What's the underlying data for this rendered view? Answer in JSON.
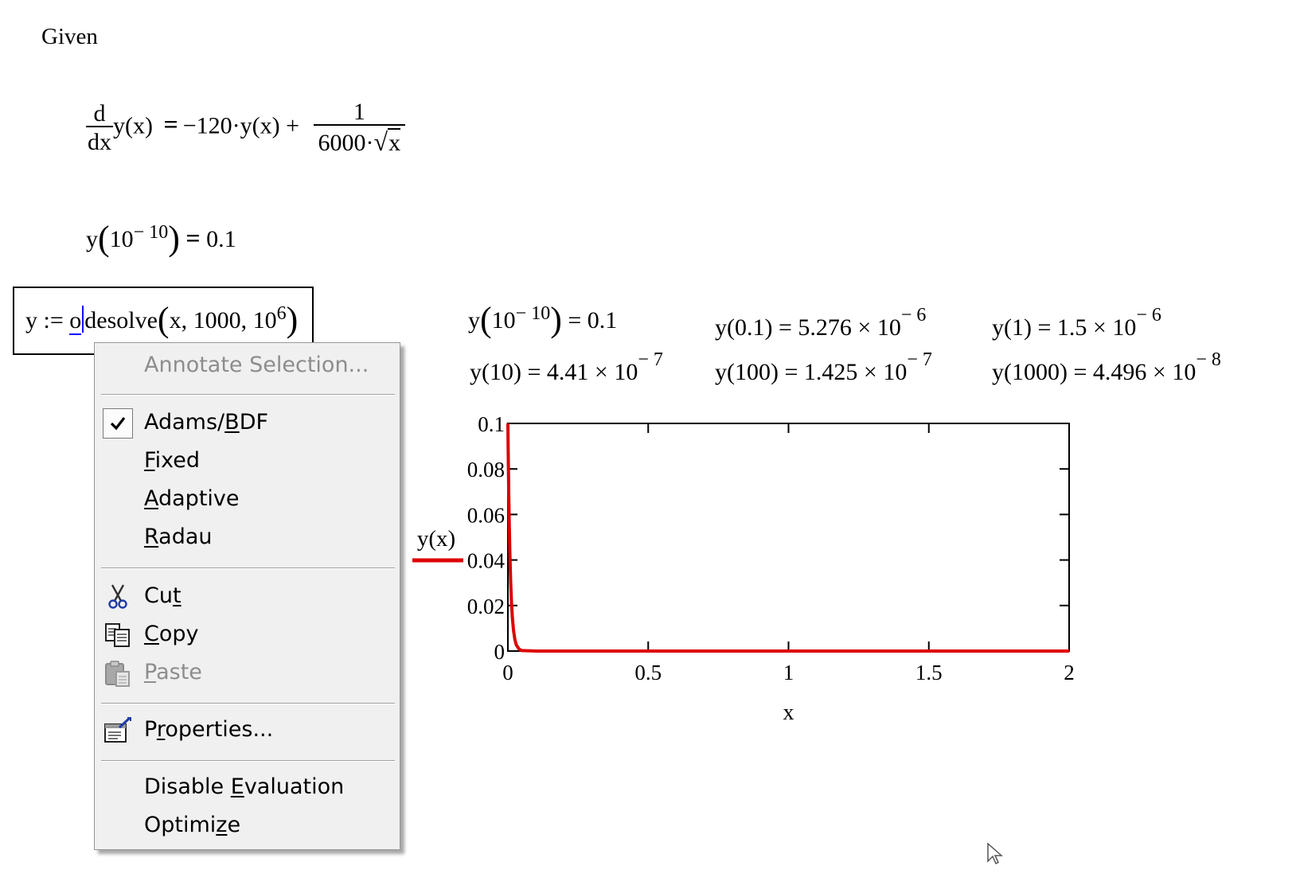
{
  "worksheet": {
    "given_label": "Given",
    "ode": {
      "d_top": "d",
      "d_bottom": "dx",
      "lhs_func": "y(x)",
      "equals": "=",
      "rhs_term": "−120·y(x) +",
      "frac_num": "1",
      "frac_den_prefix": "6000·",
      "frac_den_radicand": "x"
    },
    "initial_condition": {
      "func": "y",
      "arg_base": "10",
      "arg_exp": "− 10",
      "equals": "=",
      "value": "0.1"
    },
    "solve_definition": {
      "lhs": "y :=",
      "func_first_char": "o",
      "func_rest": "desolve",
      "args": "x, 1000, 10",
      "arg_exp": "6"
    }
  },
  "results": {
    "r1": {
      "func": "y",
      "arg_base": "10",
      "arg_exp": "− 10",
      "rhs": "= 0.1"
    },
    "r2": {
      "lhs": "y(0.1)",
      "rhs": "= 5.276 × 10",
      "exp": "− 6"
    },
    "r3": {
      "lhs": "y(1)",
      "rhs": "= 1.5 × 10",
      "exp": "− 6"
    },
    "r4": {
      "lhs": "y(10)",
      "rhs": "= 4.41 × 10",
      "exp": "− 7"
    },
    "r5": {
      "lhs": "y(100)",
      "rhs": "= 1.425 × 10",
      "exp": "− 7"
    },
    "r6": {
      "lhs": "y(1000)",
      "rhs": "= 4.496 × 10",
      "exp": "− 8"
    }
  },
  "context_menu": {
    "annotate": "Annotate Selection...",
    "adams_pre": "Adams/",
    "adams_u": "B",
    "adams_post": "DF",
    "fixed_u": "F",
    "fixed_post": "ixed",
    "adaptive_u": "A",
    "adaptive_post": "daptive",
    "radau_u": "R",
    "radau_post": "adau",
    "cut_pre": "Cu",
    "cut_u": "t",
    "copy_u": "C",
    "copy_post": "opy",
    "paste_u": "P",
    "paste_post": "aste",
    "props_pre": "P",
    "props_u": "r",
    "props_post": "operties...",
    "disable_pre": "Disable ",
    "disable_u": "E",
    "disable_post": "valuation",
    "optimize_pre": "Optimi",
    "optimize_u": "z",
    "optimize_post": "e",
    "icons": {
      "check": "checkmark-icon",
      "cut": "scissors-icon",
      "copy": "copy-icon",
      "paste": "paste-icon",
      "properties": "properties-icon"
    }
  },
  "chart_data": {
    "type": "line",
    "xlabel": "x",
    "ylabel": "y(x)",
    "xlim": [
      0,
      2
    ],
    "ylim": [
      0,
      0.1
    ],
    "x_ticks": [
      "0",
      "0.5",
      "1",
      "1.5",
      "2"
    ],
    "y_ticks": [
      "0",
      "0.02",
      "0.04",
      "0.06",
      "0.08",
      "0.1"
    ],
    "grid": false,
    "series": [
      {
        "name": "y(x)",
        "color": "#dd0000",
        "x": [
          0.0,
          0.001,
          0.002,
          0.003,
          0.005,
          0.007,
          0.01,
          0.013,
          0.016,
          0.02,
          0.025,
          0.03,
          0.04,
          0.05,
          0.1,
          0.5,
          1.0,
          1.5,
          2.0
        ],
        "y": [
          0.1,
          0.0887,
          0.0787,
          0.0698,
          0.0549,
          0.0432,
          0.0301,
          0.021,
          0.0147,
          0.0091,
          0.005,
          0.0027,
          0.0008,
          0.0002,
          5e-06,
          2.3e-06,
          1.5e-06,
          1.2e-06,
          1e-06
        ]
      }
    ]
  }
}
